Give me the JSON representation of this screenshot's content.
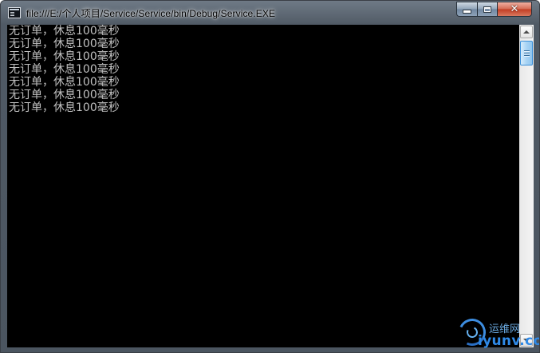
{
  "window": {
    "title": "file:///E:/个人项目/Service/Service/bin/Debug/Service.EXE",
    "icon": "console-app-icon",
    "controls": {
      "minimize": "minimize-icon",
      "maximize": "maximize-icon",
      "close_glyph": "✕"
    }
  },
  "console": {
    "background": "#000000",
    "text_color": "#c0c0c0",
    "lines": [
      "无订单，休息100毫秒",
      "无订单，休息100毫秒",
      "无订单，休息100毫秒",
      "无订单，休息100毫秒",
      "无订单，休息100毫秒",
      "无订单，休息100毫秒",
      "无订单，休息100毫秒"
    ]
  },
  "watermark": {
    "top_text": "运维网",
    "bottom_text": "iyunv.com"
  },
  "colors": {
    "close_button": "#c94a2f",
    "scroll_thumb": "#a9d4f4",
    "watermark_blue": "#2f8ae8"
  }
}
